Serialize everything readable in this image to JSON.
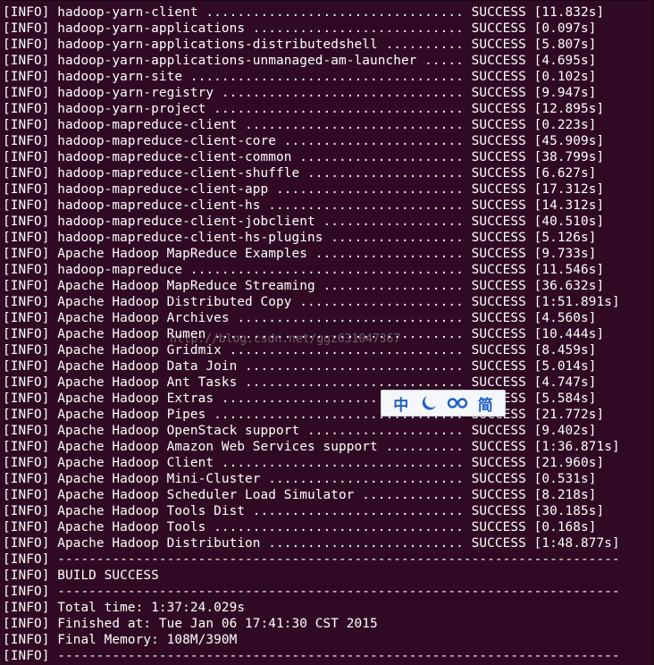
{
  "terminal": {
    "lines": [
      "[INFO] hadoop-yarn-client ................................. SUCCESS [11.832s]",
      "[INFO] hadoop-yarn-applications ........................... SUCCESS [0.097s]",
      "[INFO] hadoop-yarn-applications-distributedshell .......... SUCCESS [5.807s]",
      "[INFO] hadoop-yarn-applications-unmanaged-am-launcher ..... SUCCESS [4.695s]",
      "[INFO] hadoop-yarn-site ................................... SUCCESS [0.102s]",
      "[INFO] hadoop-yarn-registry ............................... SUCCESS [9.947s]",
      "[INFO] hadoop-yarn-project ................................ SUCCESS [12.895s]",
      "[INFO] hadoop-mapreduce-client ............................ SUCCESS [0.223s]",
      "[INFO] hadoop-mapreduce-client-core ....................... SUCCESS [45.909s]",
      "[INFO] hadoop-mapreduce-client-common ..................... SUCCESS [38.799s]",
      "[INFO] hadoop-mapreduce-client-shuffle .................... SUCCESS [6.627s]",
      "[INFO] hadoop-mapreduce-client-app ........................ SUCCESS [17.312s]",
      "[INFO] hadoop-mapreduce-client-hs ......................... SUCCESS [14.312s]",
      "[INFO] hadoop-mapreduce-client-jobclient .................. SUCCESS [40.510s]",
      "[INFO] hadoop-mapreduce-client-hs-plugins ................. SUCCESS [5.126s]",
      "[INFO] Apache Hadoop MapReduce Examples ................... SUCCESS [9.733s]",
      "[INFO] hadoop-mapreduce ................................... SUCCESS [11.546s]",
      "[INFO] Apache Hadoop MapReduce Streaming .................. SUCCESS [36.632s]",
      "[INFO] Apache Hadoop Distributed Copy ..................... SUCCESS [1:51.891s]",
      "[INFO] Apache Hadoop Archives ............................. SUCCESS [4.560s]",
      "[INFO] Apache Hadoop Rumen ................................ SUCCESS [10.444s]",
      "[INFO] Apache Hadoop Gridmix .............................. SUCCESS [8.459s]",
      "[INFO] Apache Hadoop Data Join ............................ SUCCESS [5.014s]",
      "[INFO] Apache Hadoop Ant Tasks ............................ SUCCESS [4.747s]",
      "[INFO] Apache Hadoop Extras ............................... SUCCESS [5.584s]",
      "[INFO] Apache Hadoop Pipes ................................ SUCCESS [21.772s]",
      "[INFO] Apache Hadoop OpenStack support .................... SUCCESS [9.402s]",
      "[INFO] Apache Hadoop Amazon Web Services support .......... SUCCESS [1:36.871s]",
      "[INFO] Apache Hadoop Client ............................... SUCCESS [21.960s]",
      "[INFO] Apache Hadoop Mini-Cluster ......................... SUCCESS [0.531s]",
      "[INFO] Apache Hadoop Scheduler Load Simulator ............. SUCCESS [8.218s]",
      "[INFO] Apache Hadoop Tools Dist ........................... SUCCESS [30.185s]",
      "[INFO] Apache Hadoop Tools ................................ SUCCESS [0.168s]",
      "[INFO] Apache Hadoop Distribution ......................... SUCCESS [1:48.877s]",
      "[INFO] ------------------------------------------------------------------------",
      "[INFO] BUILD SUCCESS",
      "[INFO] ------------------------------------------------------------------------",
      "[INFO] Total time: 1:37:24.029s",
      "[INFO] Finished at: Tue Jan 06 17:41:30 CST 2015",
      "[INFO] Final Memory: 108M/390M",
      "[INFO] ------------------------------------------------------------------------"
    ]
  },
  "watermark": "http://blog.csdn.net/ggz631047367",
  "ime_toolbar": {
    "chinese_mode_label": "中",
    "punctuation_icon": "moon-icon",
    "soft_keyboard_icon": "glasses-icon",
    "simplified_label": "简"
  },
  "colors": {
    "background": "#300a24",
    "text": "#ffffff",
    "ime_accent": "#1f5fc4"
  }
}
